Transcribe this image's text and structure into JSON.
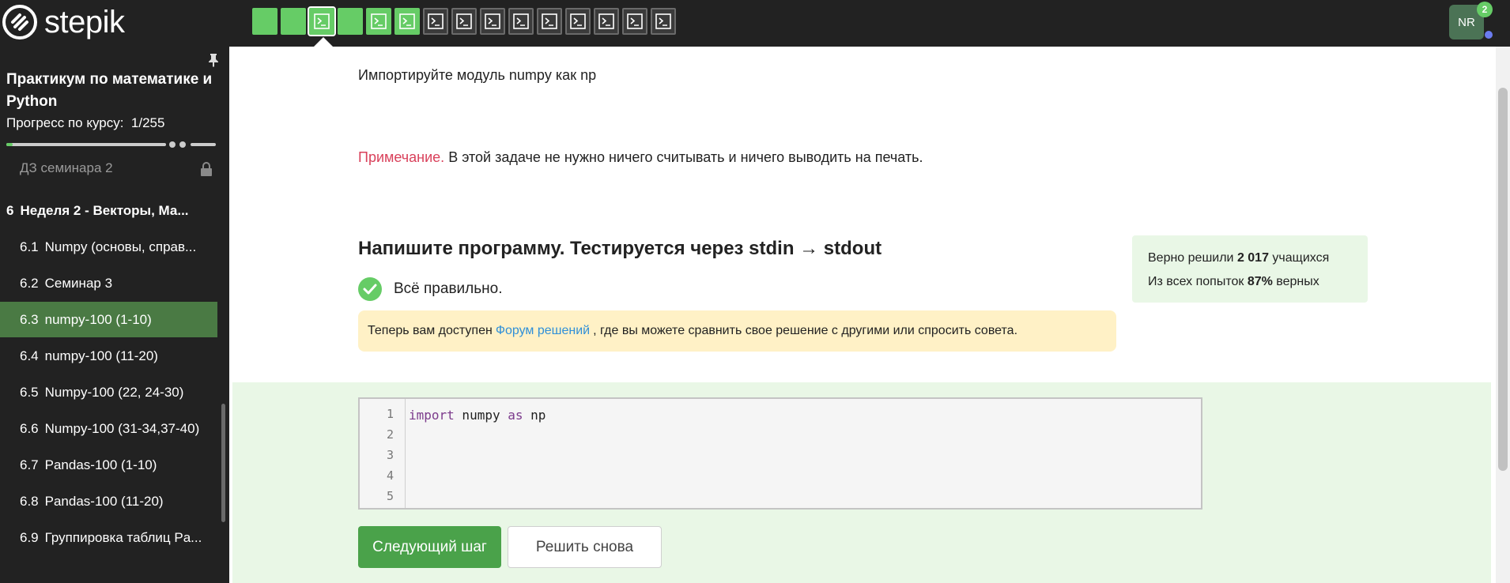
{
  "header": {
    "logo_text": "stepik",
    "steps": [
      {
        "kind": "text",
        "state": "solved"
      },
      {
        "kind": "text",
        "state": "solved"
      },
      {
        "kind": "code",
        "state": "solved",
        "current": true
      },
      {
        "kind": "text",
        "state": "solved"
      },
      {
        "kind": "code",
        "state": "solved"
      },
      {
        "kind": "code",
        "state": "solved"
      },
      {
        "kind": "code",
        "state": "todo"
      },
      {
        "kind": "code",
        "state": "todo"
      },
      {
        "kind": "code",
        "state": "todo"
      },
      {
        "kind": "code",
        "state": "todo"
      },
      {
        "kind": "code",
        "state": "todo"
      },
      {
        "kind": "code",
        "state": "todo"
      },
      {
        "kind": "code",
        "state": "todo"
      },
      {
        "kind": "code",
        "state": "todo"
      },
      {
        "kind": "code",
        "state": "todo"
      }
    ],
    "avatar_initials": "NR",
    "notification_count": "2"
  },
  "sidebar": {
    "course_title": "Практикум по математике и Python",
    "progress_label": "Прогресс по курсу:",
    "progress_value": "1/255",
    "progress_fraction": 0.004,
    "lessons": [
      {
        "num": "",
        "label": "ДЗ семинара 2",
        "state": "locked"
      },
      {
        "num": "6",
        "label": "Неделя 2 - Векторы, Ма...",
        "state": "module"
      },
      {
        "num": "6.1",
        "label": "Numpy (основы, справ...",
        "state": "normal"
      },
      {
        "num": "6.2",
        "label": "Семинар 3",
        "state": "normal"
      },
      {
        "num": "6.3",
        "label": "numpy-100 (1-10)",
        "state": "active"
      },
      {
        "num": "6.4",
        "label": "numpy-100 (11-20)",
        "state": "normal"
      },
      {
        "num": "6.5",
        "label": "Numpy-100 (22, 24-30)",
        "state": "normal"
      },
      {
        "num": "6.6",
        "label": "Numpy-100 (31-34,37-40)",
        "state": "normal"
      },
      {
        "num": "6.7",
        "label": "Pandas-100 (1-10)",
        "state": "normal"
      },
      {
        "num": "6.8",
        "label": "Pandas-100 (11-20)",
        "state": "normal"
      },
      {
        "num": "6.9",
        "label": "Группировка таблиц Pa...",
        "state": "normal"
      }
    ]
  },
  "main": {
    "instruction": "Импортируйте модуль numpy как np",
    "note_label": "Примечание.",
    "note_text": " В этой задаче не нужно ничего считывать и ничего выводить на печать.",
    "task_title": "Напишите программу. Тестируется через stdin → stdout",
    "status_text": "Всё правильно.",
    "forum_prefix": "Теперь вам доступен",
    "forum_link": "Форум решений",
    "forum_suffix": ", где вы можете сравнить свое решение с другими или спросить совета.",
    "stats_line1_prefix": "Верно решили ",
    "stats_line1_value": "2 017",
    "stats_line1_suffix": " учащихся",
    "stats_line2_prefix": "Из всех попыток ",
    "stats_line2_value": "87%",
    "stats_line2_suffix": " верных",
    "editor": {
      "line_numbers": [
        "1",
        "2",
        "3",
        "4",
        "5"
      ],
      "code_kw1": "import",
      "code_mid": " numpy ",
      "code_kw2": "as",
      "code_end": " np"
    },
    "next_button": "Следующий шаг",
    "retry_button": "Решить снова"
  },
  "colors": {
    "accent_green": "#66cc66",
    "button_green": "#4aa24a",
    "note_red": "#d9415b",
    "link_blue": "#2f8fd8"
  }
}
